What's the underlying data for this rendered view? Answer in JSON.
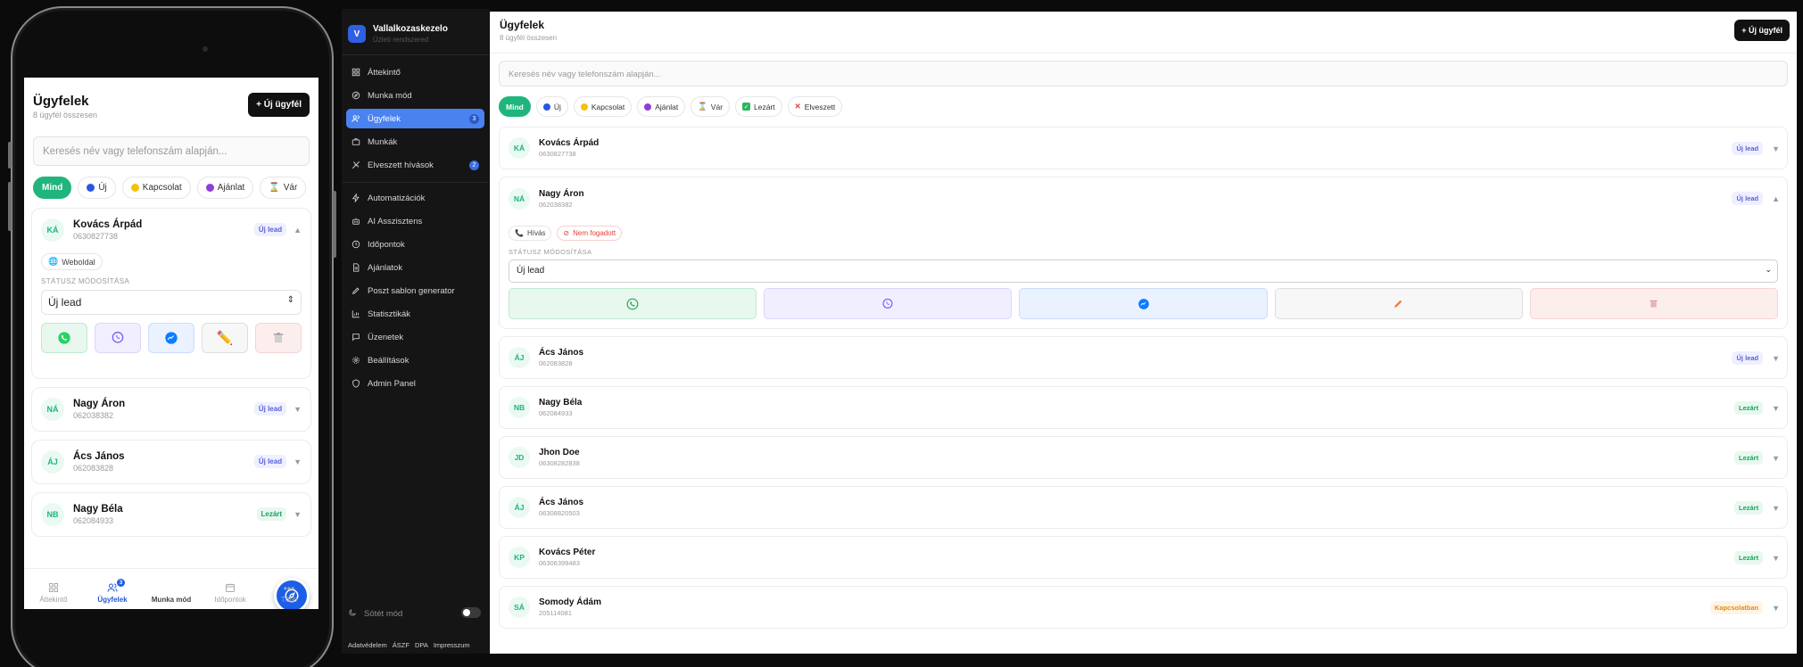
{
  "mobile": {
    "title": "Ügyfelek",
    "subtitle": "8 ügyfél összesen",
    "new_button": "+ Új ügyfél",
    "search_placeholder": "Keresés név vagy telefonszám alapján...",
    "chips": [
      {
        "label": "Mind",
        "active": true,
        "icon": ""
      },
      {
        "label": "Új",
        "icon": "blue-dot"
      },
      {
        "label": "Kapcsolat",
        "icon": "yellow-dot"
      },
      {
        "label": "Ajánlat",
        "icon": "purple-dot"
      },
      {
        "label": "Vár",
        "icon": "hourglass"
      }
    ],
    "expanded_card": {
      "initials": "KÁ",
      "name": "Kovács Árpád",
      "phone": "0630827738",
      "badge": "Új lead",
      "source_tag": "Weboldal",
      "status_label": "STÁTUSZ MÓDOSÍTÁSA",
      "status_value": "Új lead"
    },
    "cards": [
      {
        "initials": "NÁ",
        "name": "Nagy Áron",
        "phone": "062038382",
        "badge": "Új lead",
        "type": "new"
      },
      {
        "initials": "ÁJ",
        "name": "Ács János",
        "phone": "062083828",
        "badge": "Új lead",
        "type": "new"
      },
      {
        "initials": "NB",
        "name": "Nagy Béla",
        "phone": "062084933",
        "badge": "Lezárt",
        "type": "closed"
      }
    ],
    "nav": [
      {
        "label": "Áttekintő",
        "icon": "grid-icon"
      },
      {
        "label": "Ügyfelek",
        "icon": "users-icon",
        "active": true,
        "badge": "3"
      },
      {
        "label": "Munka mód",
        "icon": "compass-icon",
        "fab": true
      },
      {
        "label": "Időpontok",
        "icon": "calendar-icon"
      },
      {
        "label": "Több",
        "icon": "more-icon"
      }
    ]
  },
  "sidebar": {
    "brand_initial": "V",
    "brand_name": "Vallalkozaskezelo",
    "brand_sub": "Üzleti rendszered",
    "items": [
      {
        "label": "Áttekintő",
        "icon": "grid-icon"
      },
      {
        "label": "Munka mód",
        "icon": "compass-icon"
      },
      {
        "label": "Ügyfelek",
        "icon": "users-icon",
        "active": true,
        "count": "3"
      },
      {
        "label": "Munkák",
        "icon": "briefcase-icon"
      },
      {
        "label": "Elveszett hívások",
        "icon": "phone-missed-icon",
        "count": "2"
      },
      {
        "label": "Automatizációk",
        "icon": "bolt-icon"
      },
      {
        "label": "AI Asszisztens",
        "icon": "bot-icon"
      },
      {
        "label": "Időpontok",
        "icon": "clock-icon"
      },
      {
        "label": "Ajánlatok",
        "icon": "document-icon"
      },
      {
        "label": "Poszt sablon generator",
        "icon": "pen-icon"
      },
      {
        "label": "Statisztikák",
        "icon": "chart-icon"
      },
      {
        "label": "Üzenetek",
        "icon": "message-icon"
      },
      {
        "label": "Beállítások",
        "icon": "gear-icon"
      },
      {
        "label": "Admin Panel",
        "icon": "shield-icon"
      }
    ],
    "dark_mode_label": "Sötét mód",
    "footer_links": [
      "Adatvédelem",
      "ÁSZF",
      "DPA",
      "Impresszum"
    ]
  },
  "main": {
    "title": "Ügyfelek",
    "subtitle": "8 ügyfél összesen",
    "new_button": "+ Új ügyfél",
    "search_placeholder": "Keresés név vagy telefonszám alapján...",
    "chips": [
      {
        "label": "Mind",
        "active": true,
        "icon": ""
      },
      {
        "label": "Új",
        "icon": "blue-dot"
      },
      {
        "label": "Kapcsolat",
        "icon": "yellow-dot"
      },
      {
        "label": "Ajánlat",
        "icon": "purple-dot"
      },
      {
        "label": "Vár",
        "icon": "hourglass"
      },
      {
        "label": "Lezárt",
        "icon": "check-box"
      },
      {
        "label": "Elveszett",
        "icon": "red-x"
      }
    ],
    "expanded": {
      "tags": [
        "Hívás",
        "Nem fogadott"
      ],
      "status_label": "STÁTUSZ MÓDOSÍTÁSA",
      "status_value": "Új lead"
    },
    "customers": [
      {
        "initials": "KÁ",
        "name": "Kovács Árpád",
        "phone": "0630827738",
        "badge": "Új lead",
        "type": "new"
      },
      {
        "initials": "NÁ",
        "name": "Nagy Áron",
        "phone": "062038382",
        "badge": "Új lead",
        "type": "new",
        "expanded": true
      },
      {
        "initials": "ÁJ",
        "name": "Ács János",
        "phone": "062083828",
        "badge": "Új lead",
        "type": "new"
      },
      {
        "initials": "NB",
        "name": "Nagy Béla",
        "phone": "062084933",
        "badge": "Lezárt",
        "type": "closed"
      },
      {
        "initials": "JD",
        "name": "Jhon Doe",
        "phone": "06308282838",
        "badge": "Lezárt",
        "type": "closed"
      },
      {
        "initials": "ÁJ",
        "name": "Ács János",
        "phone": "06308820503",
        "badge": "Lezárt",
        "type": "closed"
      },
      {
        "initials": "KP",
        "name": "Kovács Péter",
        "phone": "06306399483",
        "badge": "Lezárt",
        "type": "closed"
      },
      {
        "initials": "SÁ",
        "name": "Somody Ádám",
        "phone": "205114081",
        "badge": "Kapcsolatban",
        "type": "contact"
      }
    ]
  },
  "colors": {
    "accent": "#1fb57c",
    "primary": "#2f5fe3",
    "sidebar_bg": "#151515"
  }
}
